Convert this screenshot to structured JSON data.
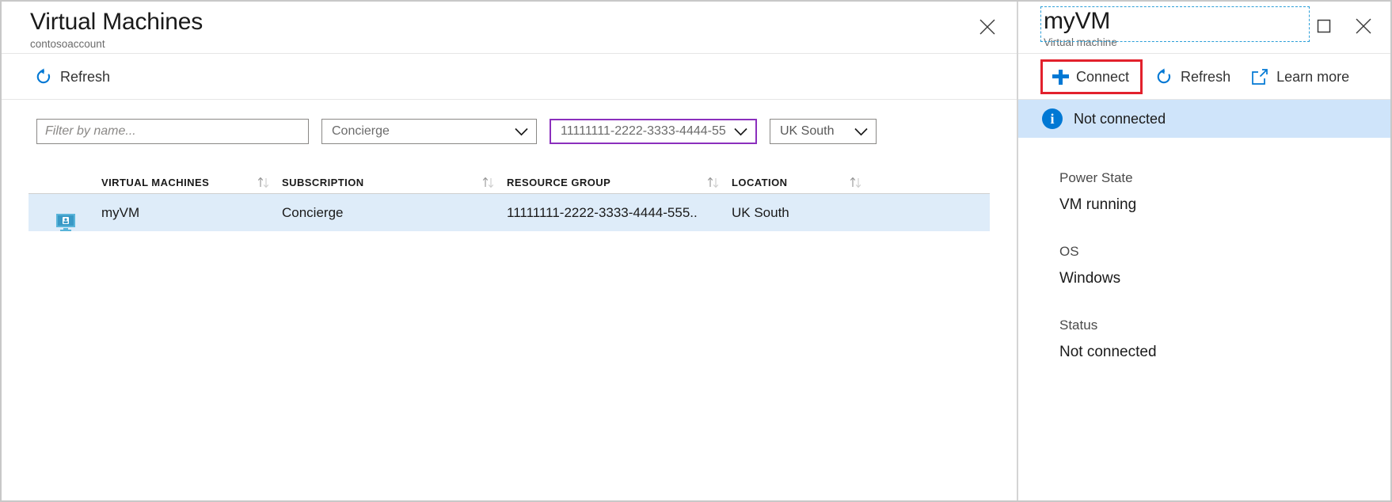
{
  "left_blade": {
    "title": "Virtual Machines",
    "subtitle": "contosoaccount",
    "close_label": "close-icon",
    "command_bar": {
      "refresh_label": "Refresh"
    },
    "filters": {
      "name_filter_placeholder": "Filter by name...",
      "name_filter_value": "",
      "subscription_value": "Concierge",
      "resource_group_value": "11111111-2222-3333-4444-555",
      "location_value": "UK South",
      "highlight_color": "#8b2fbd"
    },
    "table": {
      "columns": [
        {
          "label": "VIRTUAL MACHINES"
        },
        {
          "label": "SUBSCRIPTION"
        },
        {
          "label": "RESOURCE GROUP"
        },
        {
          "label": "LOCATION"
        }
      ],
      "rows": [
        {
          "icon": "virtual-machine-icon",
          "name": "myVM",
          "subscription": "Concierge",
          "resource_group": "11111111-2222-3333-4444-555..",
          "location": "UK South",
          "selected": true,
          "row_color": "#deecf9"
        }
      ]
    }
  },
  "right_blade": {
    "title": "myVM",
    "subtitle": "Virtual machine",
    "window_controls": {
      "maximize_label": "maximize-icon",
      "close_label": "close-icon"
    },
    "command_bar": {
      "connect_label": "Connect",
      "refresh_label": "Refresh",
      "learn_more_label": "Learn more",
      "connect_highlight_color": "#e2212c"
    },
    "notification": {
      "icon": "info-icon",
      "glyph": "i",
      "text": "Not connected",
      "background": "#cfe4fa"
    },
    "properties": [
      {
        "label": "Power State",
        "value": "VM running"
      },
      {
        "label": "OS",
        "value": "Windows"
      },
      {
        "label": "Status",
        "value": "Not connected"
      }
    ]
  },
  "theme": {
    "accent": "#0078d4",
    "selection_blue": "#deecf9",
    "border": "#c8c8c8"
  }
}
